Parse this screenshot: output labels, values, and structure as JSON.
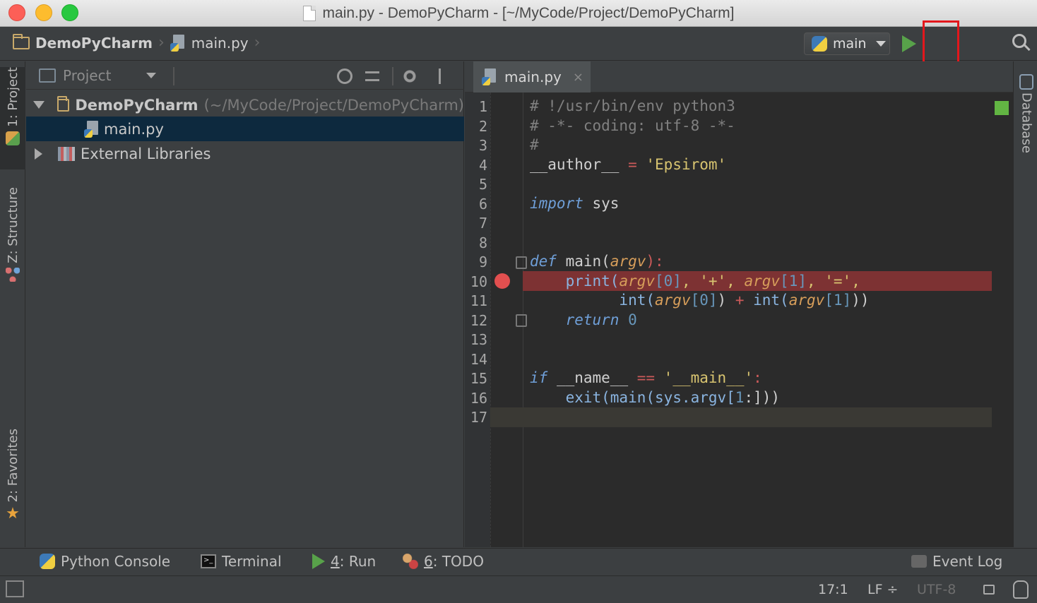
{
  "window": {
    "title": "main.py - DemoPyCharm - [~/MyCode/Project/DemoPyCharm]",
    "traffic_lights": [
      "close",
      "minimize",
      "maximize"
    ]
  },
  "navbar": {
    "breadcrumbs": [
      "DemoPyCharm",
      "main.py"
    ],
    "run_config": "main",
    "actions": [
      "run-icon",
      "debug-icon",
      "run-with-coverage-icon",
      "search-icon"
    ],
    "highlighted_action": "debug",
    "highlight_color": "#e3171c"
  },
  "left_strip": {
    "tabs": [
      {
        "label": "1: Project",
        "active": true
      },
      {
        "label": "Z: Structure",
        "active": false
      },
      {
        "label": "2: Favorites",
        "active": false
      }
    ]
  },
  "right_strip": {
    "tabs": [
      {
        "label": "Database"
      }
    ]
  },
  "project": {
    "header": "Project",
    "tree": [
      {
        "label": "DemoPyCharm",
        "hint": "(~/MyCode/Project/DemoPyCharm)",
        "expanded": true
      },
      {
        "label": "main.py",
        "selected": true
      },
      {
        "label": "External Libraries",
        "expanded": false
      }
    ]
  },
  "editor": {
    "tab": "main.py",
    "close_glyph": "×",
    "line_numbers": [
      "1",
      "2",
      "3",
      "4",
      "5",
      "6",
      "7",
      "8",
      "9",
      "10",
      "11",
      "12",
      "13",
      "14",
      "15",
      "16",
      "17"
    ],
    "breakpoint_line": 10,
    "current_line": 17,
    "code": {
      "l1": "# !/usr/bin/env python3",
      "l2": "# -*- coding: utf-8 -*-",
      "l3": "#",
      "l4_a": "__author__ ",
      "l4_op": "=",
      "l4_str": " 'Epsirom'",
      "l6_kw": "import",
      "l6_rest": " sys",
      "l9_kw": "def",
      "l9_fn": " main(",
      "l9_param": "argv",
      "l9_end": "):",
      "l10_a": "    print(",
      "l10_b": "argv",
      "l10_c": "[0]",
      "l10_d": ", '+', ",
      "l10_e": "argv",
      "l10_f": "[1]",
      "l10_g": ", '=',",
      "l11_a": "          int(",
      "l11_b": "argv",
      "l11_c": "[0]",
      "l11_d": ") ",
      "l11_op": "+",
      "l11_e": " int(",
      "l11_f": "argv",
      "l11_g": "[1]",
      "l11_h": "))",
      "l12_kw": "    return",
      "l12_num": " 0",
      "l15_kw": "if",
      "l15_a": " __name__ ",
      "l15_op": "==",
      "l15_str": " '__main__'",
      "l15_end": ":",
      "l16_a": "    exit(main(sys.argv[",
      "l16_num": "1",
      "l16_b": ":]))"
    }
  },
  "bottom_tools": {
    "python_console": "Python Console",
    "terminal": "Terminal",
    "terminal_icon": ">_",
    "run_num": "4",
    "run_label": ": Run",
    "todo_num": "6",
    "todo_label": ": TODO",
    "event_log": "Event Log"
  },
  "status": {
    "position": "17:1",
    "line_sep": "LF ÷",
    "encoding": "UTF-8"
  }
}
